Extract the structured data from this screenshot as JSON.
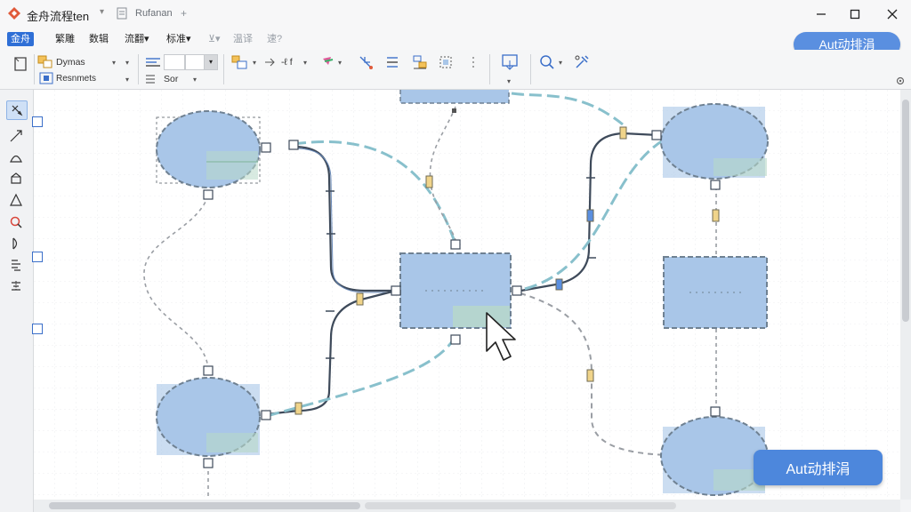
{
  "titlebar": {
    "app_title": "金舟流程ten",
    "doc_tab": "Rufanan",
    "doc_tab_suffix": "+"
  },
  "menu": {
    "items": [
      {
        "label": "金舟",
        "active": true
      },
      {
        "label": "繁雕"
      },
      {
        "label": "数辑"
      },
      {
        "label": "流翻▾"
      },
      {
        "label": "标准▾"
      },
      {
        "label": "⊻▾",
        "dim": true
      },
      {
        "label": "温译",
        "dim": true
      },
      {
        "label": "速?",
        "dim": true
      }
    ]
  },
  "auto_layout": {
    "top_label": "Aut动排涓",
    "float_label": "Aut动排涓"
  },
  "ribbon": {
    "dynamic_label": "Dymas",
    "resize_label": "Resnmets",
    "sort_label": "Sor",
    "scale_label": "-ℓ f"
  },
  "colors": {
    "shape_fill": "#a9c6e8",
    "shape_stroke": "#6f8192",
    "accent": "#2f6fd6",
    "connector_dark": "#3e4a5a",
    "connector_teal": "#88c0cc",
    "connector_gray": "#9a9ea4"
  }
}
